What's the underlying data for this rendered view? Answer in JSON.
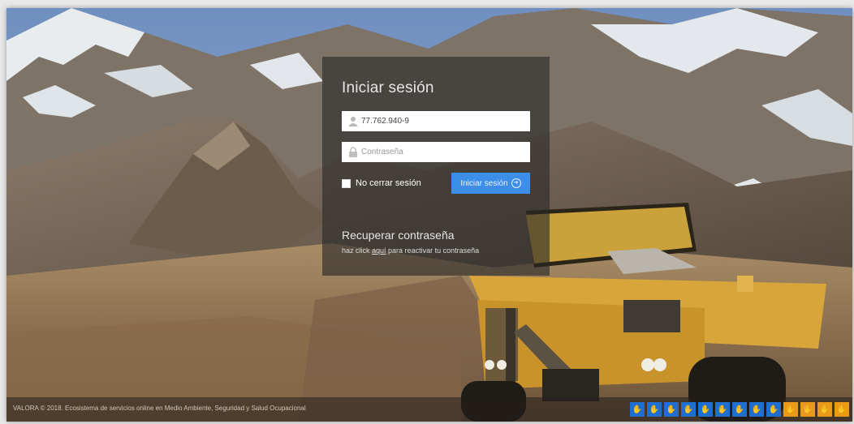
{
  "login": {
    "title": "Iniciar sesión",
    "username_value": "77.762.940-9",
    "password_placeholder": "Contraseña",
    "remember_label": "No cerrar sesión",
    "submit_label": "Iniciar sesión",
    "recover_title": "Recuperar contraseña",
    "recover_prefix": "haz click ",
    "recover_link": "aquí",
    "recover_suffix": " para reactivar tu contraseña"
  },
  "footer": {
    "text": "VALORA © 2018. Ecosistema de servicios online en Medio Ambiente, Seguridad y Salud Ocupacional"
  },
  "tray_icons": [
    {
      "name": "hand-icon-1",
      "color": "blue",
      "glyph": "✋"
    },
    {
      "name": "hand-icon-2",
      "color": "blue",
      "glyph": "✋"
    },
    {
      "name": "hand-icon-3",
      "color": "blue",
      "glyph": "✋"
    },
    {
      "name": "hand-icon-4",
      "color": "blue",
      "glyph": "✋"
    },
    {
      "name": "hand-icon-5",
      "color": "blue",
      "glyph": "✋"
    },
    {
      "name": "hand-icon-6",
      "color": "blue",
      "glyph": "✋"
    },
    {
      "name": "hand-icon-7",
      "color": "blue",
      "glyph": "✋"
    },
    {
      "name": "hand-icon-8",
      "color": "blue",
      "glyph": "✋"
    },
    {
      "name": "hand-icon-9",
      "color": "blue",
      "glyph": "✋"
    },
    {
      "name": "hand-icon-orange-1",
      "color": "orange",
      "glyph": "✋"
    },
    {
      "name": "hand-icon-orange-2",
      "color": "orange",
      "glyph": "✋"
    },
    {
      "name": "hand-icon-orange-3",
      "color": "orange",
      "glyph": "✋"
    },
    {
      "name": "hand-icon-orange-4",
      "color": "orange",
      "glyph": "✋"
    }
  ],
  "colors": {
    "primary_button": "#3d8ee8",
    "panel_background": "rgba(40,40,40,0.62)",
    "tray_blue": "#1f6fd1",
    "tray_orange": "#e89a18"
  }
}
